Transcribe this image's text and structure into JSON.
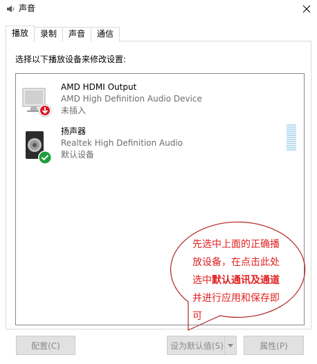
{
  "window": {
    "title": "声音",
    "title_icon": "speaker-icon",
    "close_icon": "close-icon"
  },
  "tabs": [
    {
      "label": "播放",
      "active": true
    },
    {
      "label": "录制",
      "active": false
    },
    {
      "label": "声音",
      "active": false
    },
    {
      "label": "通信",
      "active": false
    }
  ],
  "instruction": "选择以下播放设备来修改设置:",
  "devices": [
    {
      "name": "AMD HDMI Output",
      "description": "AMD High Definition Audio Device",
      "status": "未插入",
      "icon": "monitor-icon",
      "badge": "unplugged-badge-icon"
    },
    {
      "name": "扬声器",
      "description": "Realtek High Definition Audio",
      "status": "默认设备",
      "icon": "speaker-icon",
      "badge": "default-check-badge-icon"
    }
  ],
  "callout": {
    "line1": "先选中上面的正确播",
    "line2": "放设备，在点击此处",
    "line3_prefix": "选中",
    "line3_bold": "默认通讯及通道",
    "line4": "并进行应用和保存即",
    "line5": "可"
  },
  "buttons": {
    "configure": "配置(C)",
    "set_default": "设为默认值(S)",
    "properties": "属性(P)"
  },
  "colors": {
    "callout_red": "#e02020",
    "default_green": "#1e9e3e",
    "unplugged_red": "#d71921"
  }
}
